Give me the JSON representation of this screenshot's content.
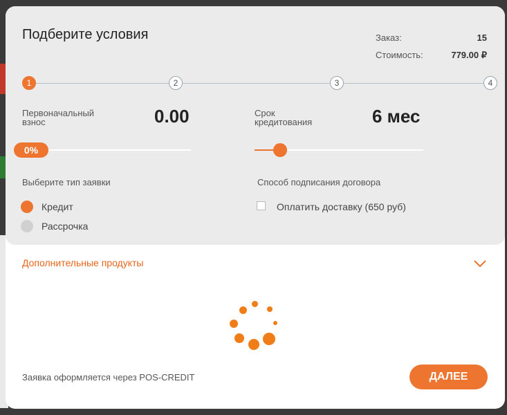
{
  "modal": {
    "title": "Подберите условия",
    "order_label": "Заказ:",
    "order_value": "15",
    "cost_label": "Стоимость:",
    "cost_value": "779.00 ₽"
  },
  "stepper": {
    "steps": [
      "1",
      "2",
      "3",
      "4"
    ],
    "active_step": 1
  },
  "down_payment": {
    "label": "Первоначальный взнос",
    "value": "0.00",
    "percent_label": "0%",
    "slider_fraction": 0
  },
  "term": {
    "label": "Срок кредитования",
    "value": "6 мес",
    "slider_fraction": 0.15
  },
  "application_type": {
    "label": "Выберите тип заявки",
    "options": [
      {
        "label": "Кредит",
        "selected": true
      },
      {
        "label": "Рассрочка",
        "selected": false
      }
    ]
  },
  "signing": {
    "label": "Способ подписания договора",
    "checkbox_label": "Оплатить доставку (650 руб)",
    "checked": false
  },
  "extra_products": {
    "label": "Дополнительные продукты",
    "icon": "chevron-down-icon"
  },
  "loading": {
    "icon": "loading-spinner-icon"
  },
  "footer": {
    "note": "Заявка оформляется через POS-CREDIT",
    "next_label": "ДАЛЕЕ"
  },
  "colors": {
    "accent": "#ee7530",
    "panel_bg": "#ebebeb",
    "link": "#e8651a"
  }
}
